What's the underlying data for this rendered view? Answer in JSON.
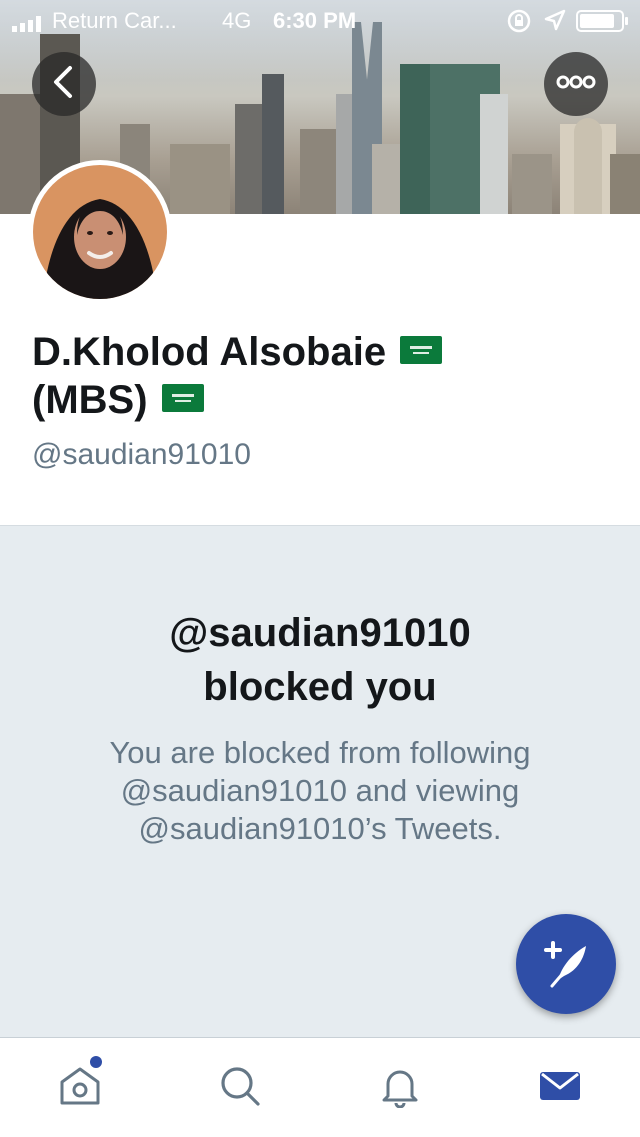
{
  "status_bar": {
    "carrier": "Return Car...",
    "network": "4G",
    "time": "6:30 PM"
  },
  "profile": {
    "name_line1": "D.Kholod Alsobaie",
    "name_line2": "(MBS)",
    "handle": "@saudian91010"
  },
  "blocked": {
    "title_line1": "@saudian91010",
    "title_line2": "blocked you",
    "description": "You are blocked from following @saudian91010 and viewing @saudian91010’s Tweets."
  },
  "icons": {
    "back": "chevron-left-icon",
    "more": "more-icon",
    "compose": "compose-tweet-icon",
    "home": "home-icon",
    "search": "search-icon",
    "notifications": "bell-icon",
    "messages": "mail-icon"
  },
  "colors": {
    "accent": "#2f4ea7",
    "text_primary": "#14171a",
    "text_secondary": "#657786",
    "blocked_bg": "#e6ecf0",
    "flag_green": "#0b7a3b"
  }
}
